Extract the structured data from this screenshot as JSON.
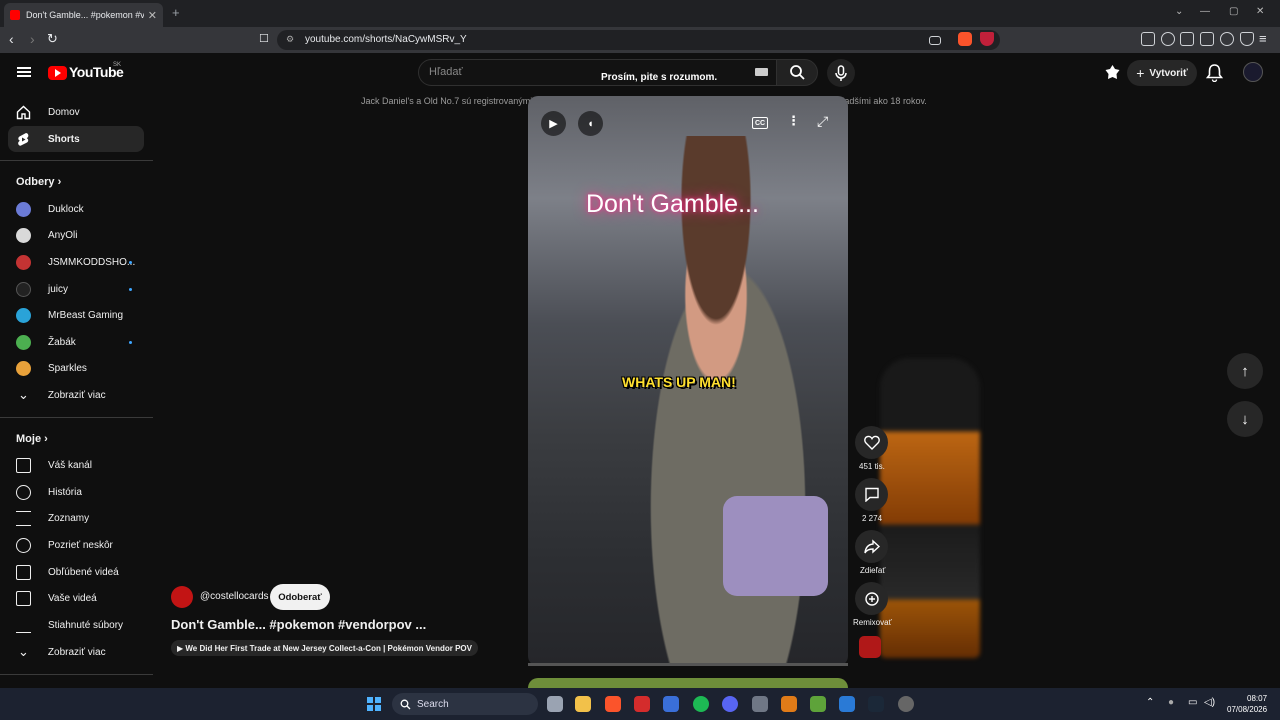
{
  "browser": {
    "tab_title": "Don't Gamble... #pokemon #vendorpov",
    "url": "youtube.com/shorts/NaCywMSRv_Y"
  },
  "header": {
    "logo_text": "YouTube",
    "region": "SK",
    "search_placeholder": "Hľadať",
    "overlay_message": "Prosím, pite s rozumom.",
    "create_label": "Vytvoriť",
    "legal_notice": "Jack Daniel's a Old No.7 sú registrovanými značkami. ©2026 Jack Daniel's. Prosím nezdieľajte tento obsah s osobami mladšími ako 18 rokov."
  },
  "sidebar": {
    "main": [
      {
        "label": "Domov",
        "icon": "home-icon"
      },
      {
        "label": "Shorts",
        "icon": "shorts-icon"
      }
    ],
    "subscriptions_title": "Odbery",
    "subscriptions": [
      {
        "label": "Duklock",
        "color": "#6b7bd6"
      },
      {
        "label": "AnyOli",
        "color": "#d9d9d9"
      },
      {
        "label": "JSMMKODDSHO...",
        "color": "#c33333"
      },
      {
        "label": "juicy",
        "color": "#222222"
      },
      {
        "label": "MrBeast Gaming",
        "color": "#2aa3d8"
      },
      {
        "label": "Žabák",
        "color": "#4caf50"
      },
      {
        "label": "Sparkles",
        "color": "#e8a13a"
      },
      {
        "label": "Zobraziť viac",
        "color": ""
      }
    ],
    "you_title": "Moje",
    "you": [
      {
        "label": "Váš kanál",
        "icon": "channel-icon"
      },
      {
        "label": "História",
        "icon": "history-icon"
      },
      {
        "label": "Zoznamy",
        "icon": "playlists-icon"
      },
      {
        "label": "Pozrieť neskôr",
        "icon": "watch-later-icon"
      },
      {
        "label": "Obľúbené videá",
        "icon": "like-icon"
      },
      {
        "label": "Vaše videá",
        "icon": "your-videos-icon"
      },
      {
        "label": "Stiahnuté súbory",
        "icon": "download-icon"
      },
      {
        "label": "Zobraziť viac",
        "icon": "chevron-down-icon"
      }
    ]
  },
  "video": {
    "title_overlay": "Don't Gamble...",
    "caption": "WHATS UP MAN!"
  },
  "actions": {
    "likes": "451 tis.",
    "comments": "2 274",
    "share": "Zdieľať",
    "remix": "Remixovať"
  },
  "short": {
    "channel": "@costellocards",
    "subscribe": "Odoberať",
    "title": "Don't Gamble... #pokemon #vendorpov ...",
    "related": "▶ We Did Her First Trade at New Jersey Collect-a-Con | Pokémon Vendor POV"
  },
  "taskbar": {
    "search": "Search",
    "time": "08:07",
    "date": "07/08/2026"
  }
}
